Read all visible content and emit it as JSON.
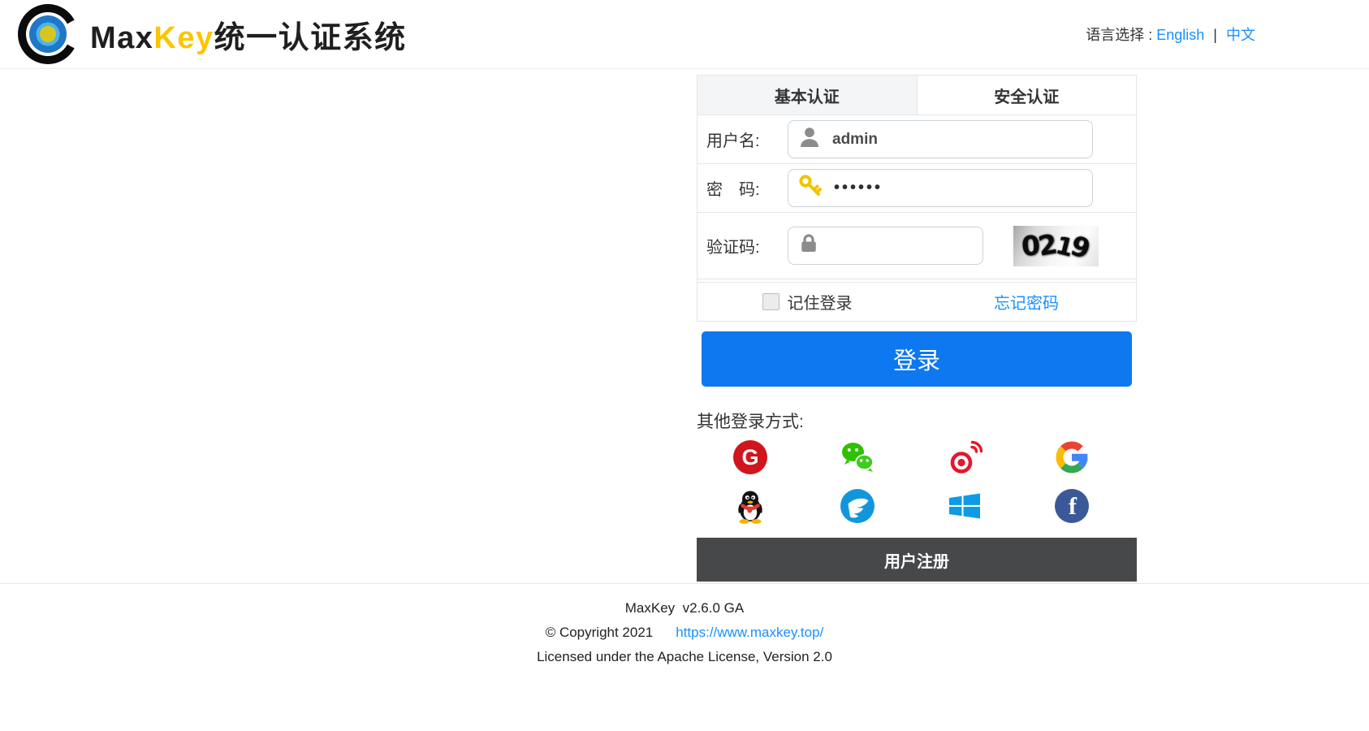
{
  "colors": {
    "primary_blue": "#0d78f0",
    "link_blue": "#1890ff",
    "brand_yellow": "#fbc500",
    "register_bar_gray": "#47484a",
    "gitee_red": "#d0151c",
    "wechat_green": "#2dc100",
    "weibo_red": "#e6162d",
    "dingtalk_blue": "#1296db",
    "windows_blue": "#0d9be5",
    "facebook_blue": "#3b5998"
  },
  "header": {
    "title": {
      "max": "Max",
      "key": "Key",
      "suffix": "统一认证系统"
    },
    "language": {
      "label": "语言选择 :",
      "english": "English",
      "separator": "|",
      "chinese": "中文"
    }
  },
  "login": {
    "tabs": [
      {
        "label": "基本认证",
        "active": true
      },
      {
        "label": "安全认证",
        "active": false
      }
    ],
    "username": {
      "label": "用户名:",
      "value": "admin",
      "icon": "user-icon"
    },
    "password": {
      "label": "密　码:",
      "value": "••••••",
      "icon": "key-icon"
    },
    "captcha": {
      "label": "验证码:",
      "value": "",
      "icon": "lock-icon",
      "image_text": "0219"
    },
    "remember": {
      "label": "记住登录",
      "checked": false
    },
    "forgot": {
      "label": "忘记密码"
    },
    "submit": {
      "label": "登录"
    },
    "other_methods": {
      "label": "其他登录方式:",
      "providers": [
        "gitee",
        "wechat",
        "weibo",
        "google",
        "qq",
        "dingtalk",
        "windows",
        "facebook"
      ]
    },
    "register": {
      "label": "用户注册"
    },
    "glyphs": {
      "gitee": "G",
      "facebook": "f"
    }
  },
  "footer": {
    "version": "MaxKey  v2.6.0 GA",
    "copyright": "© Copyright 2021",
    "link": "https://www.maxkey.top/",
    "license": "Licensed under the Apache License, Version 2.0"
  }
}
